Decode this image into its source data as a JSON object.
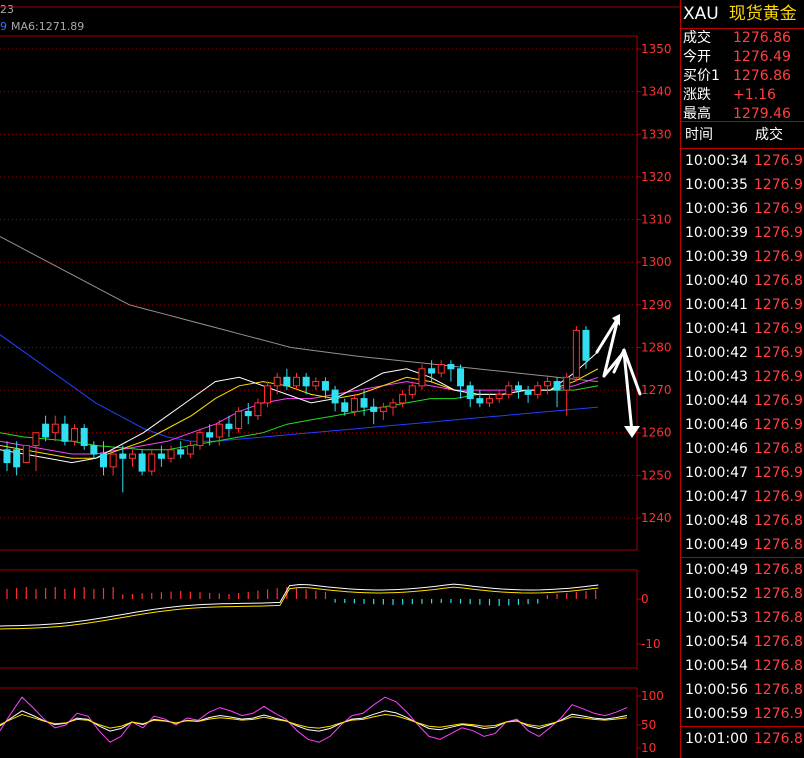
{
  "header": {
    "top_clip_text": "23",
    "code_fragment": "9",
    "ma6_label": "MA6:1271.89"
  },
  "colors": {
    "up": "#ff3030",
    "down": "#30e0f0",
    "ma_white": "#ffffff",
    "ma_yellow": "#ffe000",
    "ma_magenta": "#ff40ff",
    "ma_green": "#20e020",
    "ma_blue": "#2040ff",
    "ma_gray": "#9a8f90",
    "grid": "#a00000"
  },
  "chart_data": {
    "type": "candlestick",
    "price_axis": {
      "ticks": [
        1350,
        1340,
        1330,
        1320,
        1310,
        1300,
        1290,
        1280,
        1270,
        1260,
        1250,
        1240
      ],
      "range": [
        1233,
        1353
      ]
    },
    "macd_axis": {
      "ticks": [
        0,
        -10
      ]
    },
    "kdj_axis": {
      "ticks": [
        100,
        50,
        10
      ]
    },
    "candles": [
      [
        1256,
        1258,
        1253,
        1251
      ],
      [
        1256,
        1258,
        1252,
        1250
      ],
      [
        1253,
        1255,
        1257,
        1254
      ],
      [
        1257,
        1259,
        1260,
        1251
      ],
      [
        1262,
        1264,
        1259,
        1258
      ],
      [
        1260,
        1264,
        1262,
        1258
      ],
      [
        1262,
        1264,
        1258,
        1257
      ],
      [
        1258,
        1262,
        1261,
        1257
      ],
      [
        1261,
        1262,
        1257,
        1256
      ],
      [
        1257,
        1258,
        1255,
        1254
      ],
      [
        1255,
        1258,
        1252,
        1250
      ],
      [
        1252,
        1254,
        1255,
        1250
      ],
      [
        1255,
        1257,
        1254,
        1246
      ],
      [
        1254,
        1256,
        1255,
        1252
      ],
      [
        1255,
        1256,
        1251,
        1250
      ],
      [
        1251,
        1256,
        1255,
        1250
      ],
      [
        1255,
        1257,
        1254,
        1252
      ],
      [
        1254,
        1257,
        1256,
        1253
      ],
      [
        1256,
        1258,
        1255,
        1254
      ],
      [
        1255,
        1258,
        1257,
        1254
      ],
      [
        1257,
        1261,
        1260,
        1256
      ],
      [
        1260,
        1262,
        1259,
        1257
      ],
      [
        1259,
        1263,
        1262,
        1257
      ],
      [
        1262,
        1264,
        1261,
        1259
      ],
      [
        1261,
        1266,
        1265,
        1260
      ],
      [
        1265,
        1267,
        1264,
        1262
      ],
      [
        1264,
        1268,
        1267,
        1263
      ],
      [
        1267,
        1272,
        1271,
        1266
      ],
      [
        1271,
        1274,
        1273,
        1269
      ],
      [
        1273,
        1275,
        1271,
        1270
      ],
      [
        1271,
        1274,
        1273,
        1270
      ],
      [
        1273,
        1274,
        1271,
        1269
      ],
      [
        1271,
        1273,
        1272,
        1270
      ],
      [
        1272,
        1273,
        1270,
        1268
      ],
      [
        1270,
        1271,
        1267,
        1265
      ],
      [
        1267,
        1268,
        1265,
        1264
      ],
      [
        1265,
        1269,
        1268,
        1264
      ],
      [
        1268,
        1270,
        1266,
        1264
      ],
      [
        1266,
        1268,
        1265,
        1262
      ],
      [
        1265,
        1267,
        1266,
        1263
      ],
      [
        1266,
        1268,
        1267,
        1264
      ],
      [
        1267,
        1270,
        1269,
        1266
      ],
      [
        1269,
        1272,
        1271,
        1268
      ],
      [
        1271,
        1276,
        1275,
        1270
      ],
      [
        1275,
        1277,
        1274,
        1272
      ],
      [
        1274,
        1277,
        1276,
        1273
      ],
      [
        1276,
        1277,
        1275,
        1272
      ],
      [
        1275,
        1276,
        1271,
        1268
      ],
      [
        1271,
        1272,
        1268,
        1266
      ],
      [
        1268,
        1270,
        1267,
        1266
      ],
      [
        1267,
        1269,
        1268,
        1266
      ],
      [
        1268,
        1270,
        1269,
        1267
      ],
      [
        1269,
        1272,
        1271,
        1268
      ],
      [
        1271,
        1272,
        1270,
        1268
      ],
      [
        1270,
        1271,
        1269,
        1267
      ],
      [
        1269,
        1272,
        1271,
        1268
      ],
      [
        1271,
        1273,
        1272,
        1269
      ],
      [
        1272,
        1273,
        1270,
        1266
      ],
      [
        1270,
        1274,
        1273,
        1264
      ],
      [
        1273,
        1285,
        1284,
        1272
      ],
      [
        1284,
        1285,
        1277,
        1275
      ]
    ],
    "ma_series": [
      {
        "color_key": "ma_gray",
        "values": [
          1306,
          1304,
          1302,
          1300,
          1298,
          1296,
          1294,
          1292,
          1290,
          1289,
          1288,
          1287,
          1286,
          1285,
          1284,
          1283,
          1282,
          1281,
          1280,
          1279.5,
          1279,
          1278.5,
          1278,
          1277.6,
          1277.2,
          1276.8,
          1276.4,
          1276,
          1275.6,
          1275.2,
          1274.8,
          1274.4,
          1274,
          1273.6,
          1273.2,
          1272.8,
          1272.4,
          1272
        ]
      },
      {
        "color_key": "ma_blue",
        "values": [
          1283,
          1279,
          1275,
          1271,
          1267,
          1264,
          1261,
          1259,
          1258,
          1258,
          1258.5,
          1259,
          1259.5,
          1260,
          1260.5,
          1261,
          1261.5,
          1262,
          1262.5,
          1263,
          1263.5,
          1264,
          1264.5,
          1265,
          1265.5,
          1266
        ]
      },
      {
        "color_key": "ma_green",
        "values": [
          1260,
          1259,
          1258.5,
          1258,
          1257,
          1256.5,
          1256,
          1256,
          1257,
          1258,
          1259,
          1260,
          1262,
          1263,
          1264,
          1265,
          1266,
          1267,
          1268,
          1268,
          1269,
          1269,
          1270,
          1270,
          1270,
          1271
        ]
      },
      {
        "color_key": "ma_magenta",
        "values": [
          1258,
          1257,
          1256,
          1255,
          1255,
          1256,
          1257,
          1258,
          1260,
          1262,
          1265,
          1267,
          1268,
          1268,
          1269,
          1270,
          1271,
          1272,
          1271,
          1270,
          1270,
          1270,
          1270,
          1270,
          1271,
          1273
        ]
      },
      {
        "color_key": "ma_yellow",
        "values": [
          1257,
          1256,
          1255,
          1254,
          1254,
          1256,
          1258,
          1261,
          1264,
          1268,
          1271,
          1272,
          1271,
          1269,
          1268,
          1269,
          1271,
          1273,
          1272,
          1270,
          1269,
          1269,
          1270,
          1270,
          1272,
          1275
        ]
      },
      {
        "color_key": "ma_white",
        "values": [
          1256,
          1255,
          1254,
          1253,
          1254,
          1257,
          1260,
          1264,
          1268,
          1272,
          1273,
          1271,
          1269,
          1267,
          1268,
          1271,
          1274,
          1275,
          1273,
          1270,
          1269,
          1269,
          1270,
          1270,
          1274,
          1279
        ]
      }
    ]
  },
  "panel": {
    "symbol": "XAU",
    "name": "现货黄金",
    "quotes": [
      {
        "label": "成交",
        "value": "1276.86"
      },
      {
        "label": "今开",
        "value": "1276.49"
      },
      {
        "label": "买价1",
        "value": "1276.86"
      },
      {
        "label": "涨跌",
        "value": "+1.16"
      },
      {
        "label": "最高",
        "value": "1279.46"
      }
    ],
    "trade_head": {
      "time": "时间",
      "price": "成交"
    },
    "trades": [
      {
        "time": "10:00:34",
        "price": "1276.9"
      },
      {
        "time": "10:00:35",
        "price": "1276.9"
      },
      {
        "time": "10:00:36",
        "price": "1276.9"
      },
      {
        "time": "10:00:39",
        "price": "1276.9"
      },
      {
        "time": "10:00:39",
        "price": "1276.9"
      },
      {
        "time": "10:00:40",
        "price": "1276.8"
      },
      {
        "time": "10:00:41",
        "price": "1276.9"
      },
      {
        "time": "10:00:41",
        "price": "1276.9"
      },
      {
        "time": "10:00:42",
        "price": "1276.9"
      },
      {
        "time": "10:00:43",
        "price": "1276.9"
      },
      {
        "time": "10:00:44",
        "price": "1276.9"
      },
      {
        "time": "10:00:46",
        "price": "1276.9"
      },
      {
        "time": "10:00:46",
        "price": "1276.8"
      },
      {
        "time": "10:00:47",
        "price": "1276.9"
      },
      {
        "time": "10:00:47",
        "price": "1276.9"
      },
      {
        "time": "10:00:48",
        "price": "1276.8"
      },
      {
        "time": "10:00:49",
        "price": "1276.8"
      },
      {
        "time": "10:00:49",
        "price": "1276.8"
      },
      {
        "time": "10:00:52",
        "price": "1276.8"
      },
      {
        "time": "10:00:53",
        "price": "1276.8"
      },
      {
        "time": "10:00:54",
        "price": "1276.8"
      },
      {
        "time": "10:00:54",
        "price": "1276.8"
      },
      {
        "time": "10:00:56",
        "price": "1276.8"
      },
      {
        "time": "10:00:59",
        "price": "1276.9"
      },
      {
        "time": "10:01:00",
        "price": "1276.8"
      }
    ]
  }
}
